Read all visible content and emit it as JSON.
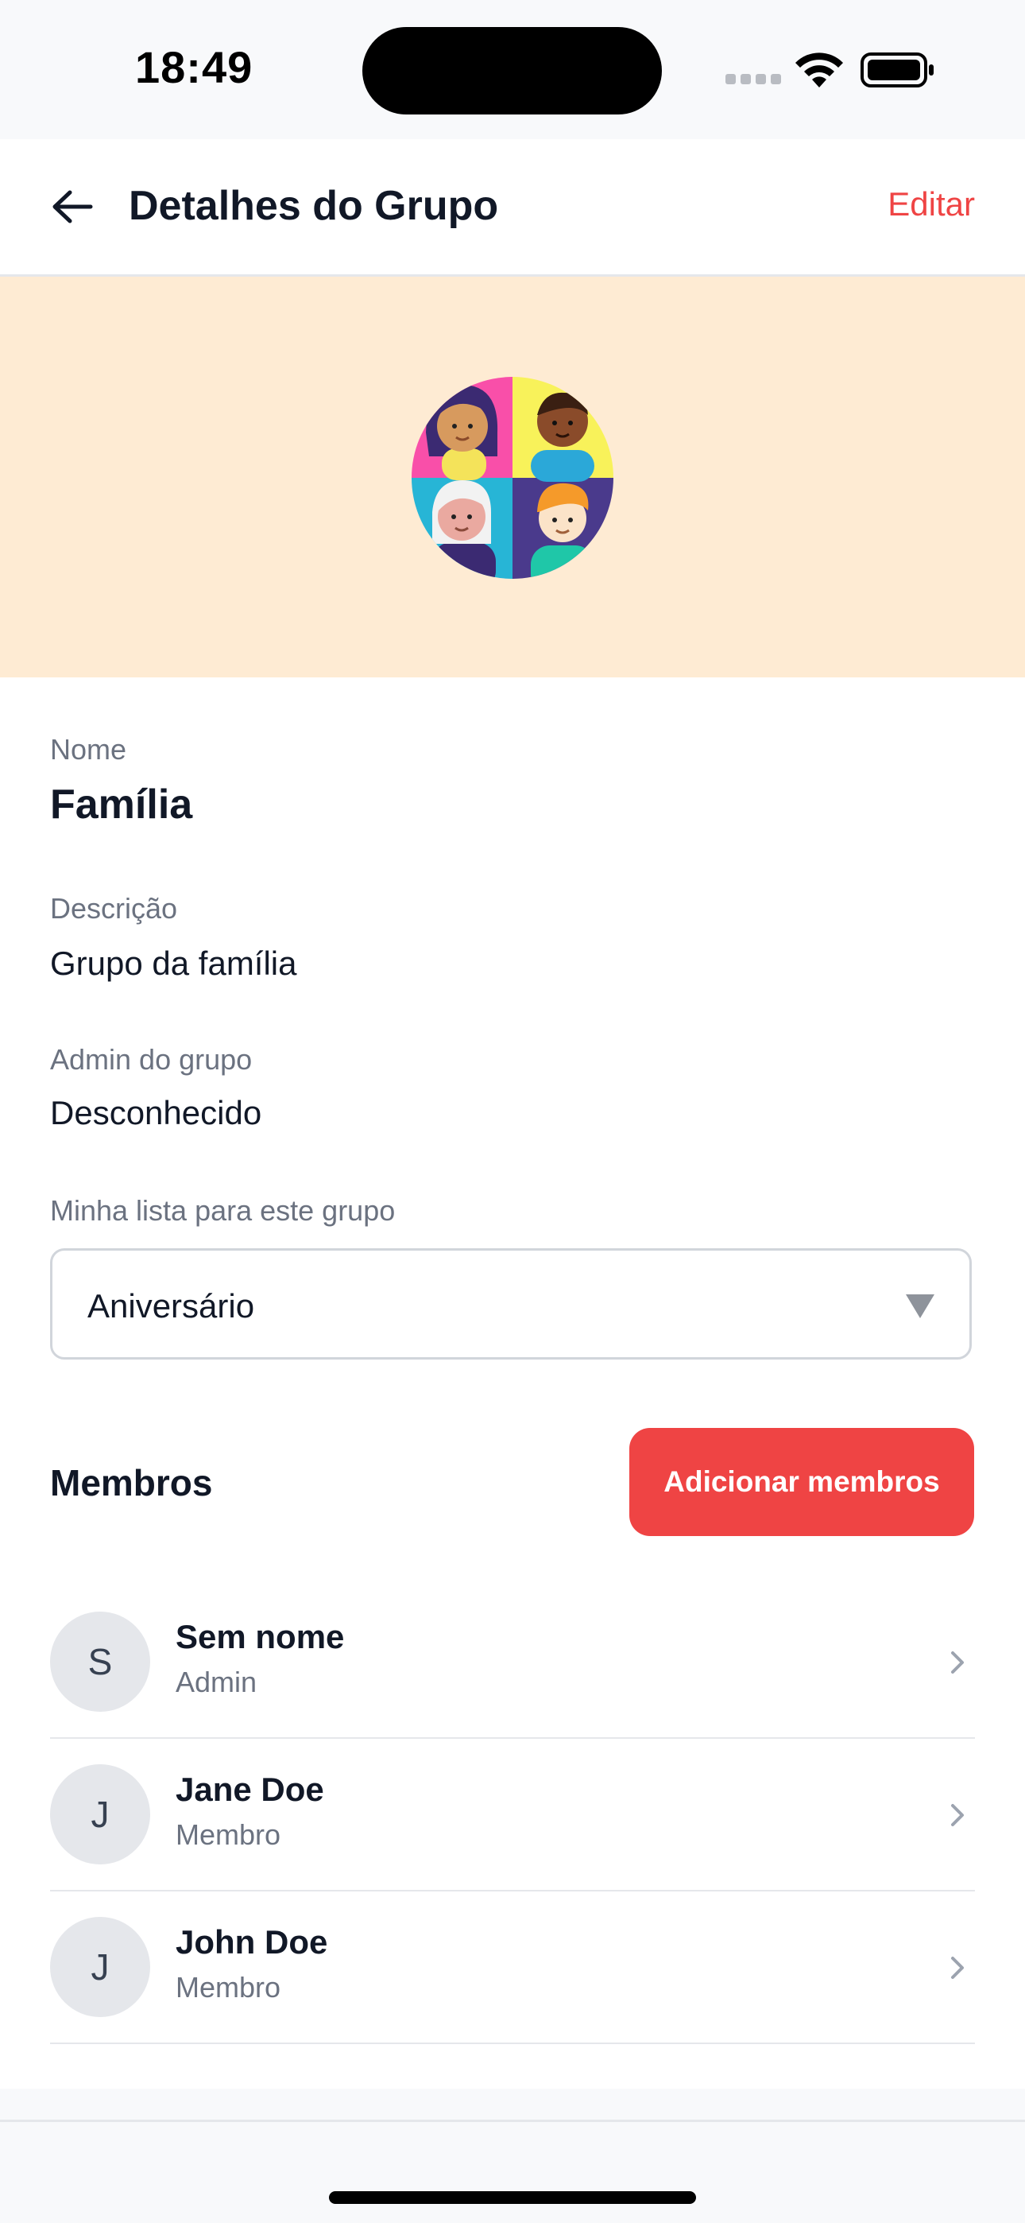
{
  "status_bar": {
    "time": "18:49"
  },
  "nav": {
    "title": "Detalhes do Grupo",
    "edit_label": "Editar"
  },
  "group": {
    "name_label": "Nome",
    "name": "Família",
    "description_label": "Descrição",
    "description": "Grupo da família",
    "admin_label": "Admin do grupo",
    "admin": "Desconhecido",
    "list_label": "Minha lista para este grupo",
    "list_selected": "Aniversário"
  },
  "members": {
    "title": "Membros",
    "add_label": "Adicionar membros",
    "items": [
      {
        "initial": "S",
        "name": "Sem nome",
        "role": "Admin"
      },
      {
        "initial": "J",
        "name": "Jane Doe",
        "role": "Membro"
      },
      {
        "initial": "J",
        "name": "John Doe",
        "role": "Membro"
      }
    ]
  },
  "colors": {
    "accent": "#ef4444",
    "hero_bg": "#feebd3",
    "text_primary": "#111827",
    "text_secondary": "#6b7280"
  },
  "icons": {
    "back": "arrow-left-icon",
    "dropdown": "triangle-down-icon",
    "chevron": "chevron-right-icon",
    "group_avatar": "group-avatar-illustration"
  }
}
